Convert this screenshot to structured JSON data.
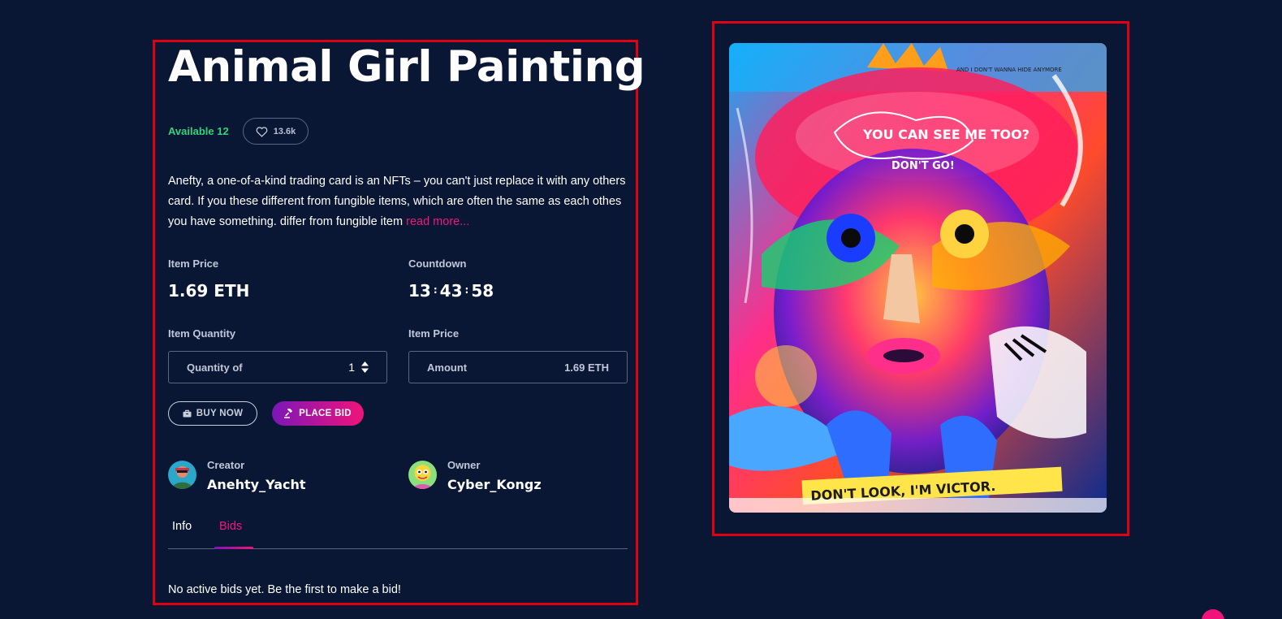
{
  "item": {
    "title": "Animal Girl Painting",
    "available": "Available 12",
    "likes": "13.6k",
    "description": "Anefty, a one-of-a-kind trading card is an NFTs – you can't just replace it with any others card. If you these different from fungible items, which are often the same as each othes you have something. differ from fungible item",
    "read_more": "read more..."
  },
  "price": {
    "label": "Item Price",
    "value": "1.69 ETH"
  },
  "countdown": {
    "label": "Countdown",
    "hours": "13",
    "minutes": "43",
    "seconds": "58",
    "separator": ":"
  },
  "quantity": {
    "label": "Item Quantity",
    "field_label": "Quantity of",
    "value": "1"
  },
  "amount": {
    "label": "Item Price",
    "field_label": "Amount",
    "value": "1.69 ETH"
  },
  "buttons": {
    "buy_now": "BUY NOW",
    "place_bid": "PLACE BID"
  },
  "creator": {
    "role": "Creator",
    "name": "Anehty_Yacht"
  },
  "owner": {
    "role": "Owner",
    "name": "Cyber_Kongz"
  },
  "tabs": [
    {
      "label": "Info",
      "active": false
    },
    {
      "label": "Bids",
      "active": true
    }
  ],
  "bids": {
    "empty_message": "No active bids yet. Be the first to make a bid!"
  },
  "artwork": {
    "texts": [
      "YOU CAN SEE ME TOO?",
      "DON'T GO!",
      "AND I DON'T WANNA HIDE ANYMORE",
      "DON'T LOOK, I'M VICTOR."
    ]
  },
  "colors": {
    "background": "#091634",
    "accent": "#f2167d",
    "available": "#31d47c",
    "highlight_frame": "#e00012"
  }
}
